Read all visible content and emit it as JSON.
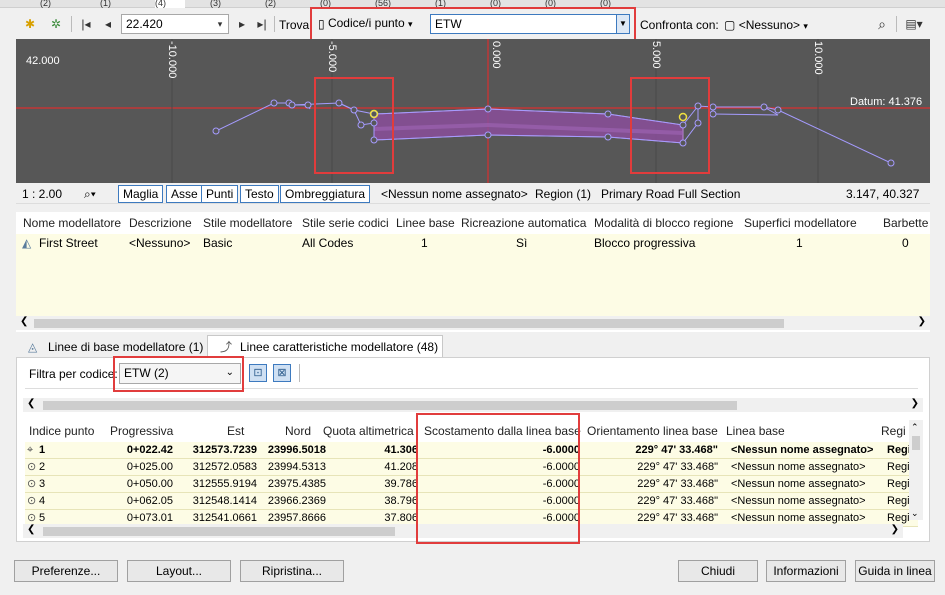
{
  "top_tabs": [
    "(2)",
    "(1)",
    "(4)",
    "(3)",
    "(2)",
    "(0)",
    "(56)",
    "(1)",
    "(0)",
    "(0)",
    "(0)"
  ],
  "toolbar": {
    "station_value": "22.420",
    "find_label": "Trova:",
    "find_mode": "Codice/i punto",
    "find_value": "ETW",
    "compare_label": "Confronta con:",
    "compare_value": "<Nessuno>"
  },
  "viewer": {
    "elevation_label": "42.000",
    "datum_label": "Datum: 41.376",
    "ticks": [
      "-10.000",
      "-5.000",
      "0.000",
      "5.000",
      "10.000"
    ]
  },
  "statusbar": {
    "scale": "1 : 2.00",
    "buttons": [
      "Maglia",
      "Asse",
      "Punti",
      "Testo",
      "Ombreggiatura"
    ],
    "baseline_name": "<Nessun nome assegnato>",
    "region": "Region (1)",
    "assembly": "Primary Road Full Section",
    "coords": "3.147, 40.327"
  },
  "grid1": {
    "headers": [
      "Nome modellatore",
      "Descrizione",
      "Stile modellatore",
      "Stile serie codici",
      "Linee base",
      "Ricreazione automatica",
      "Modalità di blocco regione",
      "Superfici modellatore",
      "Barbette"
    ],
    "row": [
      "First Street",
      "<Nessuno>",
      "Basic",
      "All Codes",
      "1",
      "Sì",
      "Blocco progressiva",
      "1",
      "0"
    ]
  },
  "tabs": {
    "baselines": "Linee di base modellatore (1)",
    "feature_lines": "Linee caratteristiche modellatore (48)"
  },
  "filter": {
    "label": "Filtra per codice:",
    "value": "ETW  (2)"
  },
  "grid2": {
    "headers": [
      "Indice punto",
      "Progressiva",
      "Est",
      "Nord",
      "Quota altimetrica",
      "Scostamento dalla linea base",
      "Orientamento linea base",
      "Linea base",
      "Regi"
    ],
    "rows": [
      [
        "1",
        "0+022.42",
        "312573.7239",
        "23996.5018",
        "41.306",
        "-6.0000",
        "229° 47' 33.468\"",
        "<Nessun nome assegnato>",
        "Regi"
      ],
      [
        "2",
        "0+025.00",
        "312572.0583",
        "23994.5313",
        "41.208",
        "-6.0000",
        "229° 47' 33.468\"",
        "<Nessun nome assegnato>",
        "Regi"
      ],
      [
        "3",
        "0+050.00",
        "312555.9194",
        "23975.4385",
        "39.786",
        "-6.0000",
        "229° 47' 33.468\"",
        "<Nessun nome assegnato>",
        "Regi"
      ],
      [
        "4",
        "0+062.05",
        "312548.1414",
        "23966.2369",
        "38.796",
        "-6.0000",
        "229° 47' 33.468\"",
        "<Nessun nome assegnato>",
        "Regi"
      ],
      [
        "5",
        "0+073.01",
        "312541.0661",
        "23957.8666",
        "37.806",
        "-6.0000",
        "229° 47' 33.468\"",
        "<Nessun nome assegnato>",
        "Regi"
      ]
    ]
  },
  "buttons": {
    "preferences": "Preferenze...",
    "layout": "Layout...",
    "restore": "Ripristina...",
    "close": "Chiudi",
    "info": "Informazioni",
    "help": "Guida in linea"
  },
  "colors": {
    "highlight": "#e13c3c",
    "accent": "#3d7abf",
    "row_bg": "#fdfce5",
    "viewer_bg": "#575757"
  }
}
